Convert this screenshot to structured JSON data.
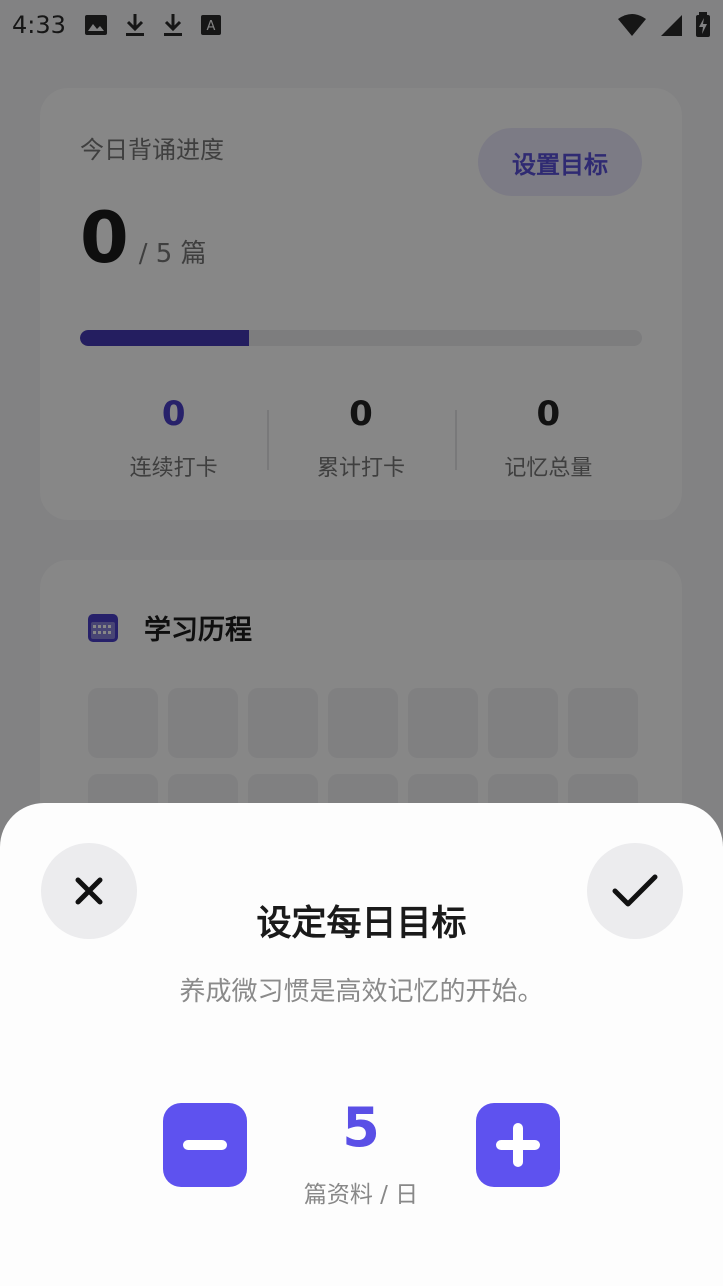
{
  "status_bar": {
    "time": "4:33",
    "icons": [
      "image-icon",
      "download-icon",
      "download-icon",
      "a-badge-icon"
    ],
    "right_icons": [
      "wifi-icon",
      "cellular-signal-icon",
      "battery-charging-icon"
    ]
  },
  "progress_card": {
    "title": "今日背诵进度",
    "set_goal_label": "设置目标",
    "done": "0",
    "total_text": "/ 5 篇",
    "progress_fraction": 0.3
  },
  "stats": [
    {
      "value": "0",
      "label": "连续打卡"
    },
    {
      "value": "0",
      "label": "累计打卡"
    },
    {
      "value": "0",
      "label": "记忆总量"
    }
  ],
  "history": {
    "icon": "calendar-icon",
    "title": "学习历程"
  },
  "sheet": {
    "close_icon": "close-icon",
    "confirm_icon": "check-icon",
    "title": "设定每日目标",
    "subtitle": "养成微习惯是高效记忆的开始。",
    "value": "5",
    "unit": "篇资料 / 日",
    "minus_icon": "minus-icon",
    "plus_icon": "plus-icon"
  },
  "colors": {
    "accent": "#5e52ef",
    "accent_dark": "#4439b5",
    "overlay": "rgba(0,0,0,0.47)"
  }
}
